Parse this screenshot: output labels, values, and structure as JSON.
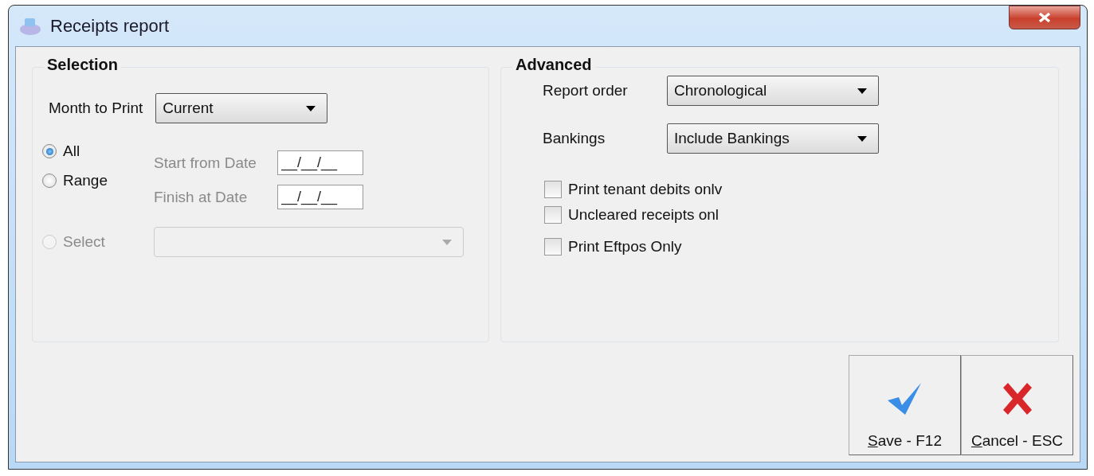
{
  "window": {
    "title": "Receipts report"
  },
  "selection": {
    "title": "Selection",
    "month": {
      "label": "Month to Print",
      "value": "Current"
    },
    "radios": [
      {
        "label": "All",
        "selected": true,
        "disabled": false
      },
      {
        "label": "Range",
        "selected": false,
        "disabled": false
      },
      {
        "label": "Select",
        "selected": false,
        "disabled": true
      }
    ],
    "dates": [
      {
        "label": "Start from Date",
        "value": "__/__/__",
        "disabled": true
      },
      {
        "label": "Finish at Date",
        "value": "__/__/__",
        "disabled": true
      }
    ],
    "select_dropdown": {
      "disabled": true
    }
  },
  "advanced": {
    "title": "Advanced",
    "dropdowns": [
      {
        "label": "Report order",
        "value": "Chronological"
      },
      {
        "label": "Bankings",
        "value": "Include Bankings"
      }
    ],
    "checkboxes": [
      {
        "label": "Print tenant debits onlv",
        "checked": false
      },
      {
        "label": "Uncleared receipts onl",
        "checked": false
      },
      {
        "label": "Print Eftpos Only",
        "checked": false
      }
    ]
  },
  "buttons": [
    {
      "label": "Save - F12",
      "kind": "save"
    },
    {
      "label": "Cancel - ESC",
      "kind": "cancel"
    }
  ]
}
